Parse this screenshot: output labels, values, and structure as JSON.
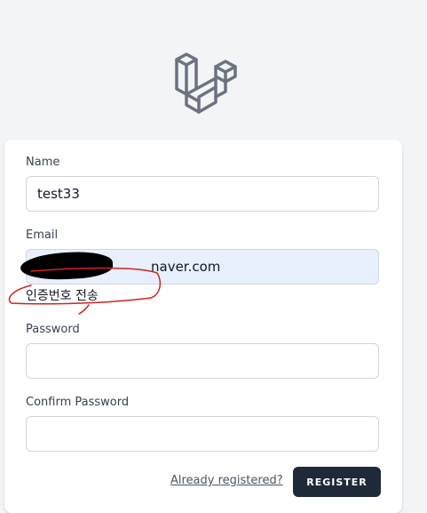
{
  "logo": {
    "icon": "laravel-logo-icon"
  },
  "form": {
    "name": {
      "label": "Name",
      "value": "test33"
    },
    "email": {
      "label": "Email",
      "value": "naver.com"
    },
    "verify_text": "인증번호 전송",
    "password": {
      "label": "Password",
      "value": ""
    },
    "confirm_password": {
      "label": "Confirm Password",
      "value": ""
    },
    "already_registered": "Already registered?",
    "register_button": "REGISTER"
  },
  "colors": {
    "background": "#f3f4f6",
    "card": "#ffffff",
    "autofill": "#e8f0fe",
    "button": "#1f2937",
    "annotation": "#d62020"
  }
}
